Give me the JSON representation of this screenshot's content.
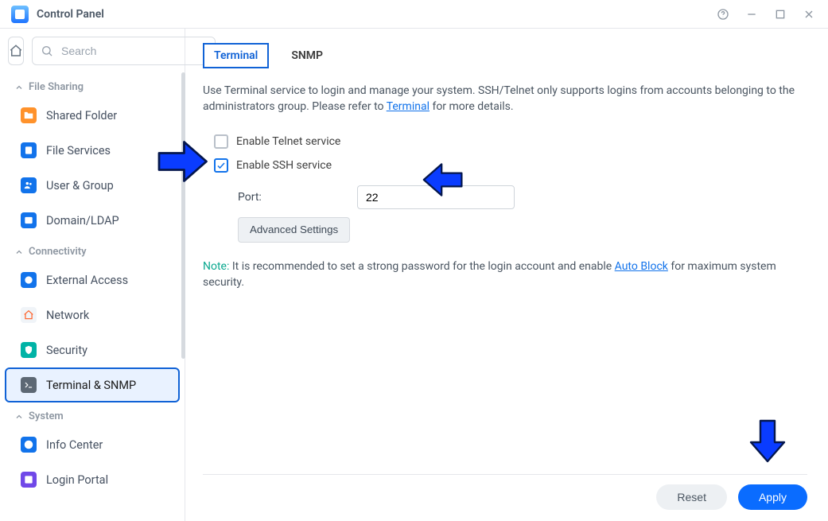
{
  "window": {
    "title": "Control Panel"
  },
  "search": {
    "placeholder": "Search"
  },
  "sections": {
    "file_sharing": "File Sharing",
    "connectivity": "Connectivity",
    "system": "System"
  },
  "sidebar": {
    "shared_folder": "Shared Folder",
    "file_services": "File Services",
    "user_group": "User & Group",
    "domain_ldap": "Domain/LDAP",
    "external_access": "External Access",
    "network": "Network",
    "security": "Security",
    "terminal_snmp": "Terminal & SNMP",
    "info_center": "Info Center",
    "login_portal": "Login Portal"
  },
  "tabs": {
    "terminal": "Terminal",
    "snmp": "SNMP"
  },
  "intro": {
    "text_a": "Use Terminal service to login and manage your system. SSH/Telnet only supports logins from accounts belonging to the administrators group. Please refer to ",
    "link": "Terminal",
    "text_b": " for more details."
  },
  "form": {
    "enable_telnet": {
      "label": "Enable Telnet service",
      "checked": false
    },
    "enable_ssh": {
      "label": "Enable SSH service",
      "checked": true
    },
    "port_label": "Port:",
    "port_value": "22",
    "advanced": "Advanced Settings"
  },
  "note": {
    "label": "Note:",
    "text_a": " It is recommended to set a strong password for the login account and enable ",
    "link": "Auto Block",
    "text_b": " for maximum system security."
  },
  "footer": {
    "reset": "Reset",
    "apply": "Apply"
  }
}
